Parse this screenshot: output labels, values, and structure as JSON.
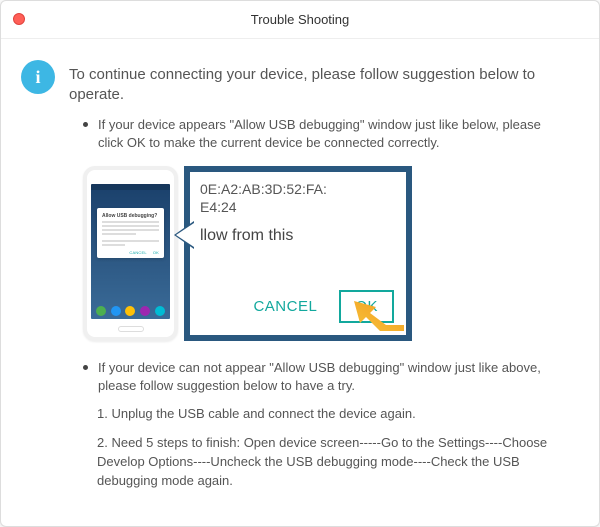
{
  "window": {
    "title": "Trouble Shooting"
  },
  "info_icon_letter": "i",
  "lead": "To continue connecting your device, please follow suggestion below to operate.",
  "bullets": {
    "b1": "If your device appears \"Allow USB debugging\" window just like below, please click OK to make the current device  be connected correctly.",
    "b2": "If your device can not appear \"Allow USB debugging\" window just like above, please follow suggestion below to have a try."
  },
  "steps": {
    "s1": "1. Unplug the USB cable and connect the device again.",
    "s2": "2. Need 5 steps to finish: Open device screen-----Go to the Settings----Choose Develop Options----Uncheck the USB debugging mode----Check the USB debugging mode again."
  },
  "phone_dialog": {
    "title": "Allow USB debugging?",
    "cancel": "CANCEL",
    "ok": "OK"
  },
  "zoom": {
    "fp1": "0E:A2:AB:3D:52:FA:",
    "fp2": "E4:24",
    "allow_fragment": "llow from this",
    "cancel": "CANCEL",
    "ok": "OK"
  }
}
